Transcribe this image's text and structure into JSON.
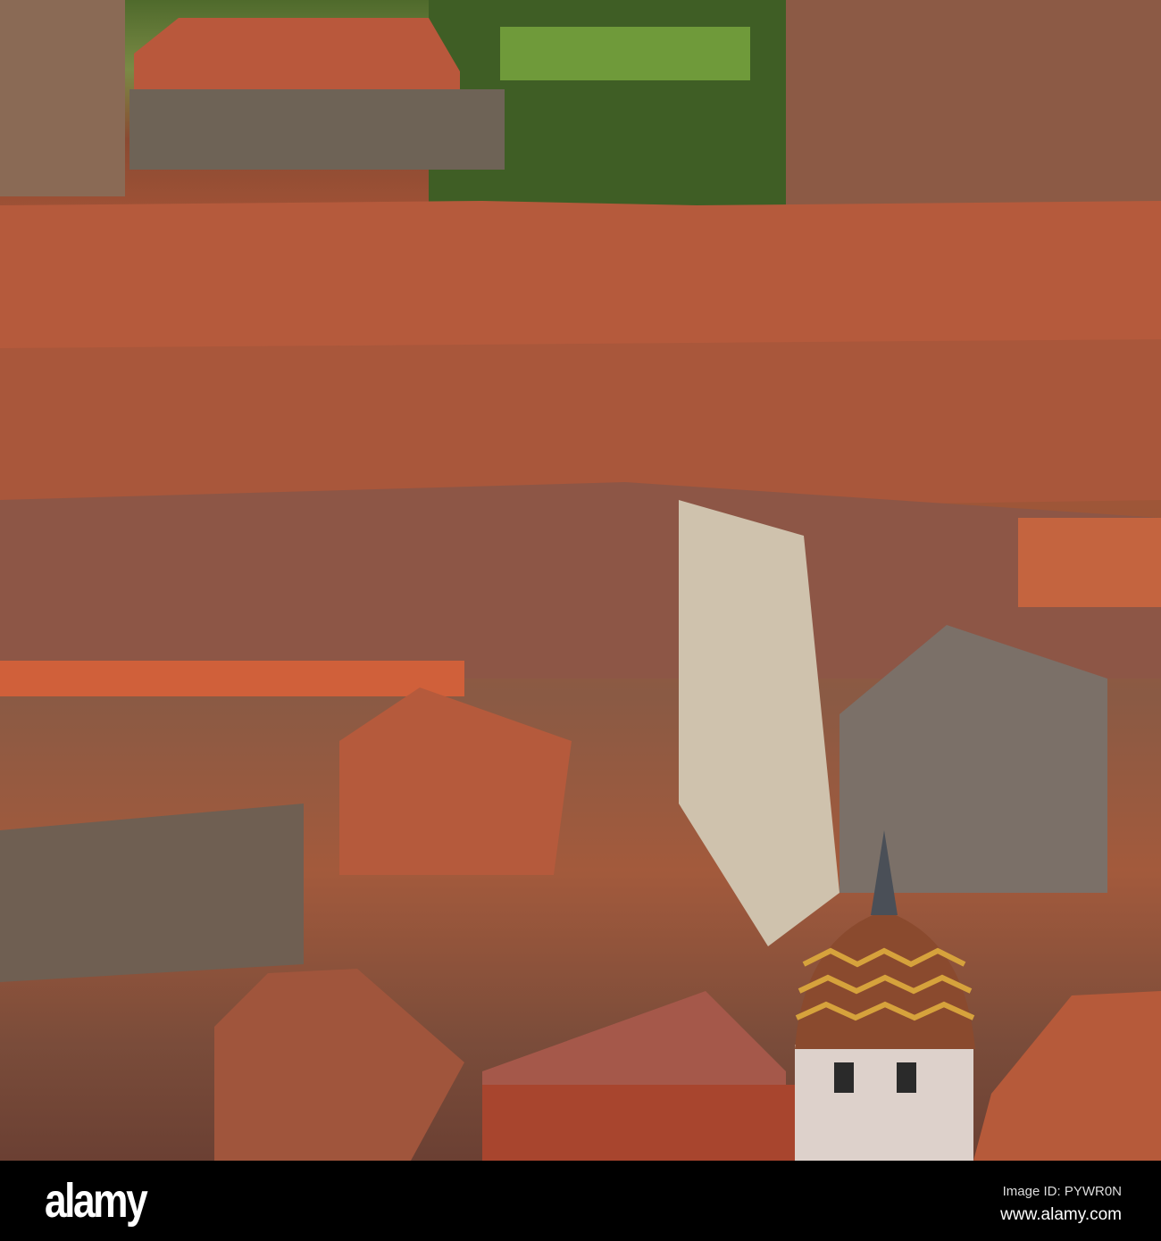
{
  "photo": {
    "subject": "Old town rooftops with chimneys and a tower with chevron-patterned tiled dome"
  },
  "watermark_bar": {
    "logo": "alamy",
    "image_id": "Image ID: PYWR0N",
    "website": "www.alamy.com"
  },
  "colors": {
    "roof": "#b4563a",
    "greenery": "#4f6a2c",
    "bar": "#000000"
  }
}
